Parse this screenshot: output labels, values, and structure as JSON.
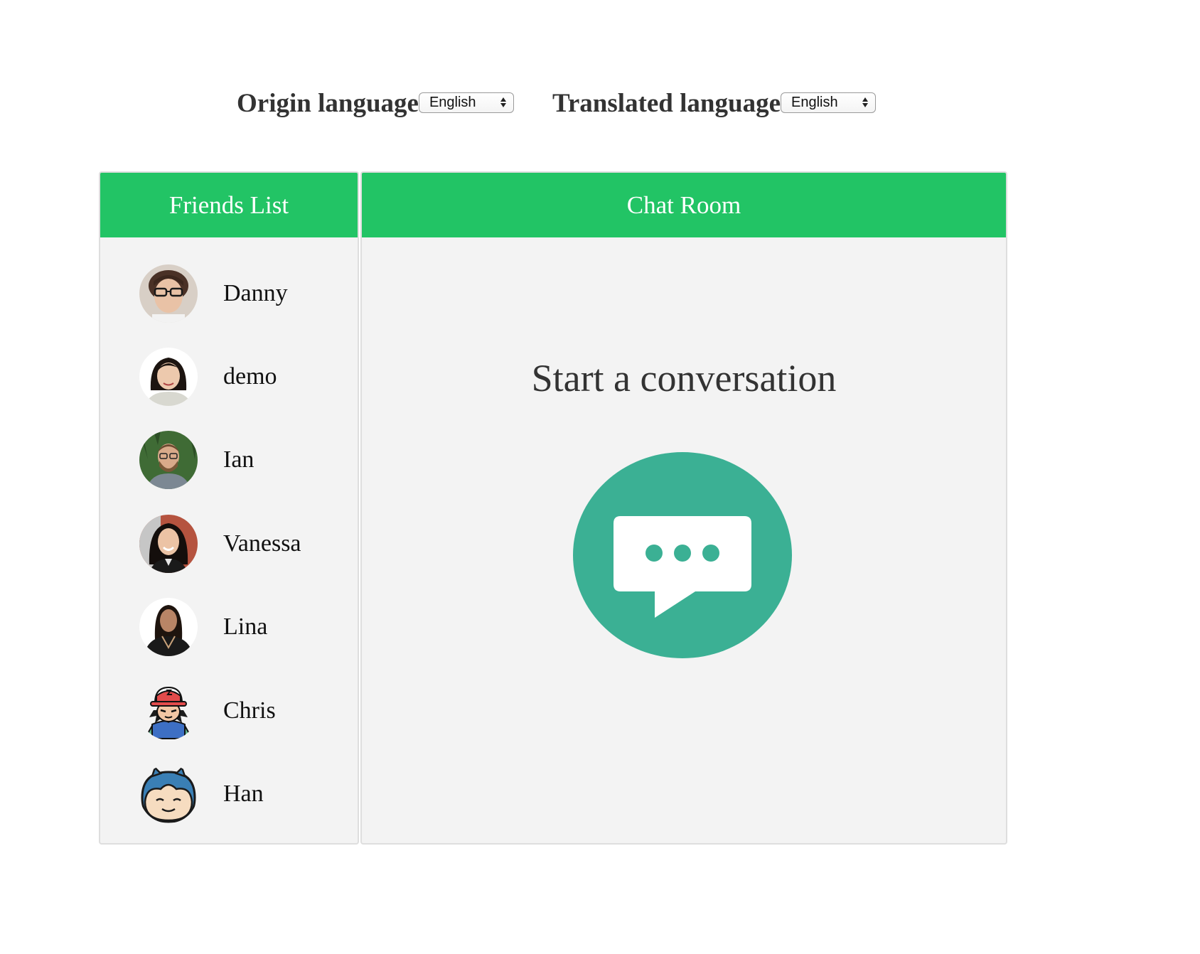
{
  "language_bar": {
    "origin_label": "Origin language",
    "origin_value": "English",
    "translated_label": "Translated language",
    "translated_value": "English"
  },
  "friends_panel": {
    "title": "Friends List",
    "friends": [
      {
        "name": "Danny",
        "avatar": "photo-avatar"
      },
      {
        "name": "demo",
        "avatar": "photo-avatar"
      },
      {
        "name": "Ian",
        "avatar": "photo-avatar"
      },
      {
        "name": "Vanessa",
        "avatar": "photo-avatar"
      },
      {
        "name": "Lina",
        "avatar": "photo-avatar"
      },
      {
        "name": "Chris",
        "avatar": "cartoon-trainer-avatar"
      },
      {
        "name": "Han",
        "avatar": "cartoon-snorlax-avatar"
      }
    ]
  },
  "chat_panel": {
    "title": "Chat Room",
    "empty_message": "Start a conversation",
    "icon": "chat-bubble-icon"
  },
  "colors": {
    "header_green": "#22c465",
    "icon_teal": "#3bb094",
    "panel_background": "#f3f3f3"
  }
}
